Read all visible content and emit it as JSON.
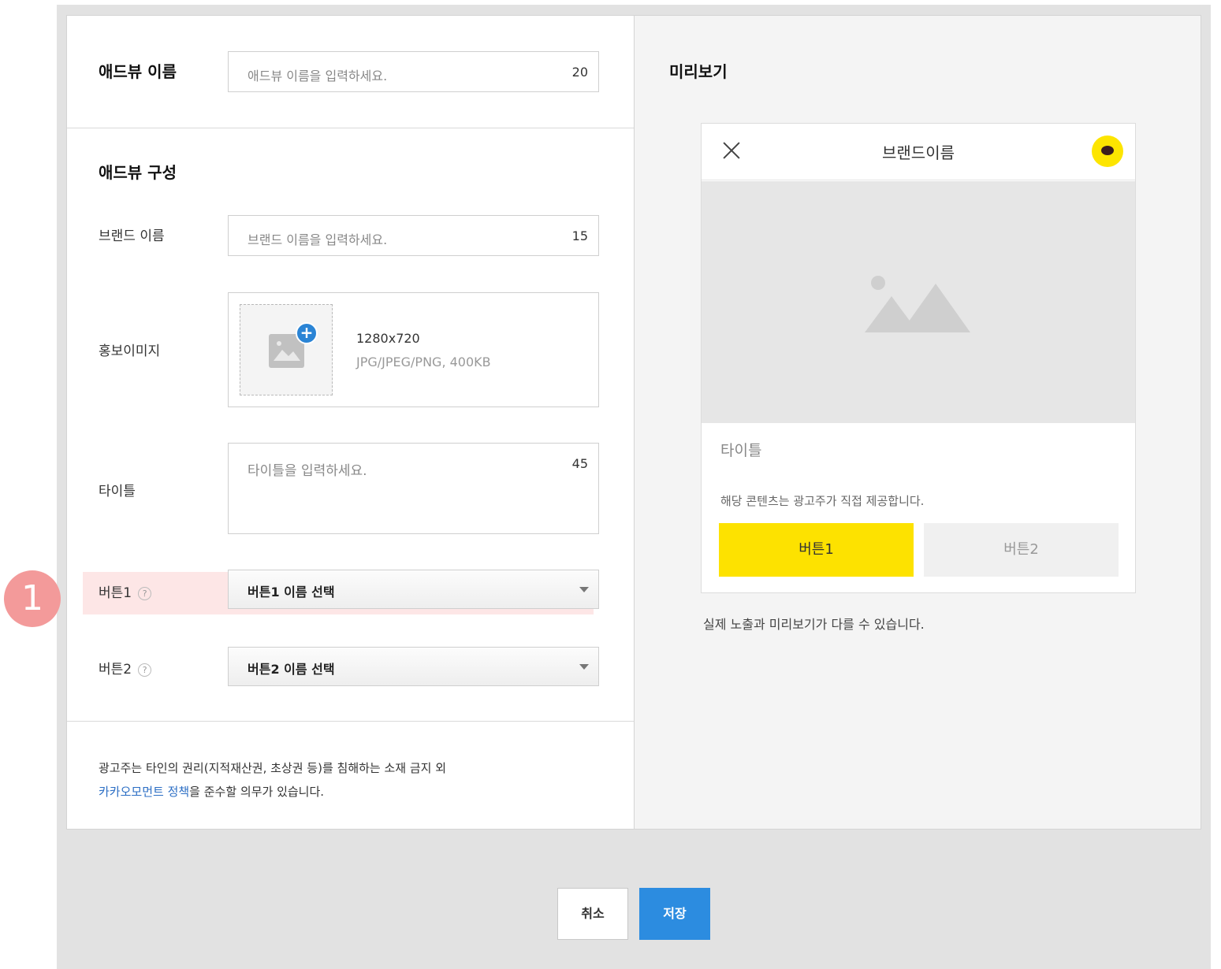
{
  "form": {
    "adview_name_label": "애드뷰 이름",
    "adview_name_placeholder": "애드뷰 이름을 입력하세요.",
    "adview_name_count": "20",
    "composition_title": "애드뷰 구성",
    "brand_label": "브랜드 이름",
    "brand_placeholder": "브랜드 이름을 입력하세요.",
    "brand_count": "15",
    "promo_image_label": "홍보이미지",
    "image_resolution": "1280x720",
    "image_formats": "JPG/JPEG/PNG, 400KB",
    "title_label": "타이틀",
    "title_placeholder": "타이틀을 입력하세요.",
    "title_count": "45",
    "button1_label": "버튼1",
    "button1_select": "버튼1 이름 선택",
    "button2_label": "버튼2",
    "button2_select": "버튼2 이름 선택",
    "help_glyph": "?",
    "notice_line1": "광고주는 타인의 권리(지적재산권, 초상권 등)를 침해하는 소재 금지 외",
    "notice_link": "카카오모먼트 정책",
    "notice_line2_rest": "을 준수할 의무가 있습니다."
  },
  "annotation_badge": "1",
  "preview": {
    "title": "미리보기",
    "brand": "브랜드이름",
    "content_title": "타이틀",
    "description": "해당 콘텐츠는 광고주가 직접 제공합니다.",
    "button1": "버튼1",
    "button2": "버튼2",
    "note": "실제 노출과 미리보기가 다를 수 있습니다.",
    "button1_color": "#fde200"
  },
  "actions": {
    "cancel": "취소",
    "save": "저장",
    "save_color": "#2c8ce0"
  }
}
